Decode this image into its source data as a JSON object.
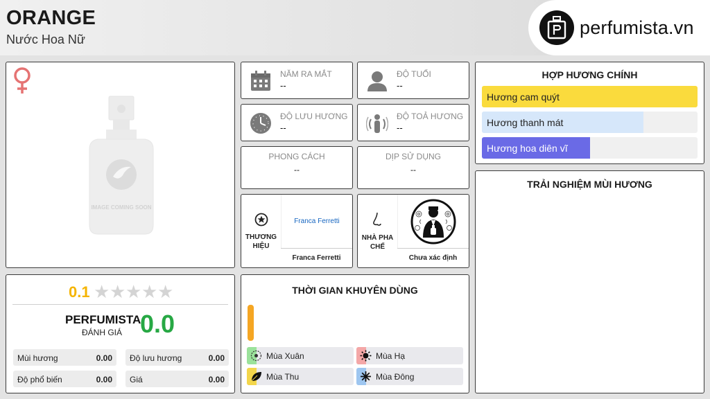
{
  "header": {
    "title": "ORANGE",
    "subtitle": "Nước Hoa Nữ",
    "logo_text": "perfumista.vn"
  },
  "image_card": {
    "gender_icon": "female-symbol-icon",
    "placeholder_text": "IMAGE COMING SOON",
    "gender_color": "#e57373"
  },
  "info": {
    "release": {
      "label": "NĂM RA MẮT",
      "value": "--",
      "icon": "calendar-icon"
    },
    "age": {
      "label": "ĐỘ TUỔI",
      "value": "--",
      "icon": "person-icon"
    },
    "longevity": {
      "label": "ĐỘ LƯU HƯƠNG",
      "value": "--",
      "icon": "clock-icon"
    },
    "sillage": {
      "label": "ĐỘ TOẢ HƯƠNG",
      "value": "--",
      "icon": "radiate-icon"
    },
    "style": {
      "label": "PHONG CÁCH",
      "value": "--"
    },
    "occasion": {
      "label": "DỊP SỬ DỤNG",
      "value": "--"
    }
  },
  "brand": {
    "label": "THƯƠNG HIỆU",
    "logo_text": "Franca Ferretti",
    "name": "Franca Ferretti",
    "icon": "star-badge-icon"
  },
  "perfumer": {
    "label": "NHÀ PHA CHẾ",
    "name": "Chưa xác định",
    "icon": "nose-icon"
  },
  "accords": {
    "title": "HỢP HƯƠNG CHÍNH",
    "items": [
      {
        "label": "Hương cam quýt",
        "fill": 1.0,
        "color": "#fadb3d"
      },
      {
        "label": "Hương thanh mát",
        "fill": 0.75,
        "color": "#d6e7fa"
      },
      {
        "label": "Hương hoa diên vĩ",
        "fill": 0.5,
        "color": "#6a6ae6"
      }
    ]
  },
  "experience": {
    "title": "TRẢI NGHIỆM MÙI HƯƠNG"
  },
  "rating": {
    "score": "0.1",
    "stars_filled": 0,
    "stars_total": 5,
    "perfumista_label": "PERFUMISTA",
    "perfumista_sub": "ĐÁNH GIÁ",
    "perfumista_score": "0.0",
    "stats": [
      {
        "label": "Mùi hương",
        "value": "0.00"
      },
      {
        "label": "Độ lưu hương",
        "value": "0.00"
      },
      {
        "label": "Độ phổ biến",
        "value": "0.00"
      },
      {
        "label": "Giá",
        "value": "0.00"
      }
    ]
  },
  "seasons": {
    "title": "THỜI GIAN KHUYÊN DÙNG",
    "accent_color": "#f5a623",
    "items": [
      {
        "label": "Mùa Xuân",
        "color": "#9be29b",
        "icon": "flower-icon"
      },
      {
        "label": "Mùa Hạ",
        "color": "#f4a7a7",
        "icon": "sun-icon"
      },
      {
        "label": "Mùa Thu",
        "color": "#f3d64b",
        "icon": "leaf-icon"
      },
      {
        "label": "Mùa Đông",
        "color": "#9ec6f0",
        "icon": "snowflake-icon"
      }
    ]
  }
}
